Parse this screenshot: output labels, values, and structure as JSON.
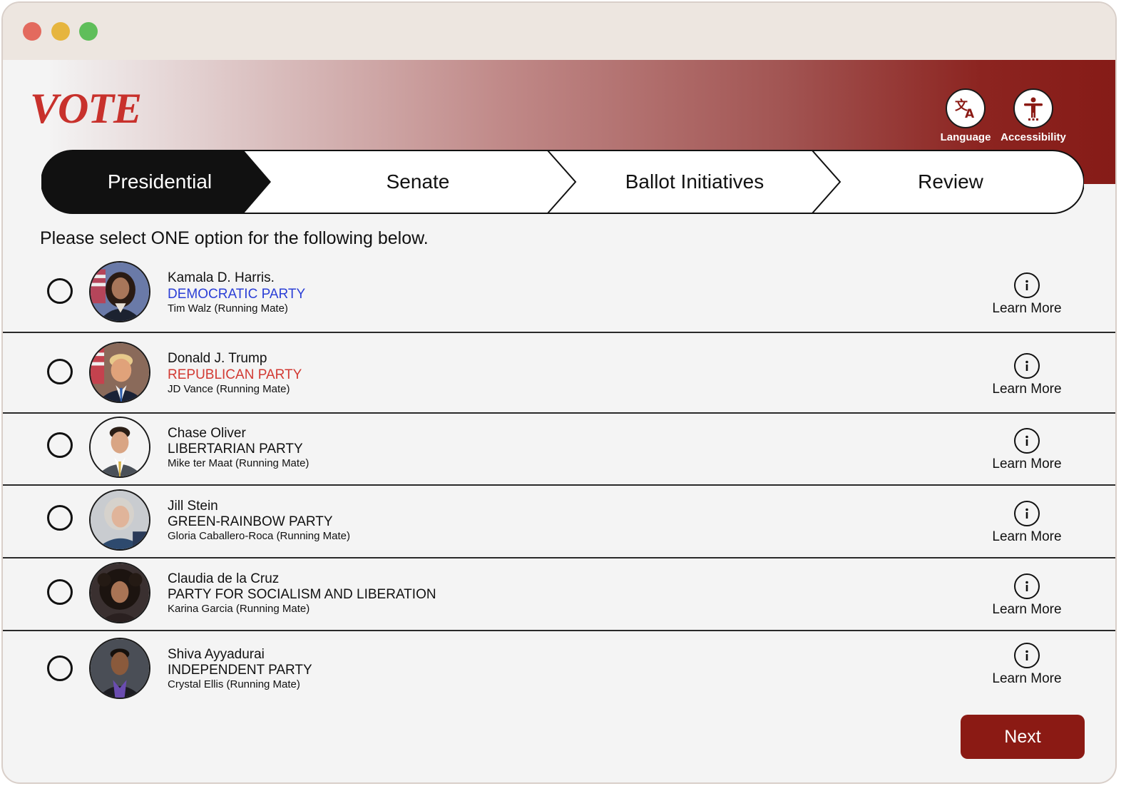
{
  "app": {
    "logo": "VOTE"
  },
  "header_actions": {
    "language_label": "Language",
    "accessibility_label": "Accessibility"
  },
  "steps": [
    {
      "label": "Presidential",
      "active": true
    },
    {
      "label": "Senate",
      "active": false
    },
    {
      "label": "Ballot Initiatives",
      "active": false
    },
    {
      "label": "Review",
      "active": false
    }
  ],
  "instruction": "Please select ONE option for the following below.",
  "candidates": [
    {
      "name": "Kamala D. Harris.",
      "party": "DEMOCRATIC PARTY",
      "party_color": "#2b3fd6",
      "running_mate": "Tim Walz (Running Mate)",
      "selected": false,
      "action_label": "Learn More"
    },
    {
      "name": "Donald J. Trump",
      "party": "REPUBLICAN PARTY",
      "party_color": "#d23a33",
      "running_mate": "JD Vance (Running Mate)",
      "selected": false,
      "action_label": "Learn More"
    },
    {
      "name": "Chase Oliver",
      "party": "LIBERTARIAN PARTY",
      "party_color": "#111111",
      "running_mate": "Mike ter Maat (Running Mate)",
      "selected": false,
      "action_label": "Learn More"
    },
    {
      "name": "Jill Stein",
      "party": "GREEN-RAINBOW PARTY",
      "party_color": "#111111",
      "running_mate": "Gloria Caballero-Roca (Running Mate)",
      "selected": false,
      "action_label": "Learn More"
    },
    {
      "name": "Claudia de la Cruz",
      "party": "PARTY FOR SOCIALISM AND LIBERATION",
      "party_color": "#111111",
      "running_mate": "Karina Garcia (Running Mate)",
      "selected": false,
      "action_label": "Learn More"
    },
    {
      "name": "Shiva Ayyadurai",
      "party": "INDEPENDENT PARTY",
      "party_color": "#111111",
      "running_mate": "Crystal Ellis (Running Mate)",
      "selected": false,
      "action_label": "Learn More"
    }
  ],
  "next_label": "Next",
  "colors": {
    "brand": "#8b1a14",
    "logo": "#c8312c",
    "active_step": "#111111",
    "democratic": "#2b3fd6",
    "republican": "#d23a33"
  }
}
